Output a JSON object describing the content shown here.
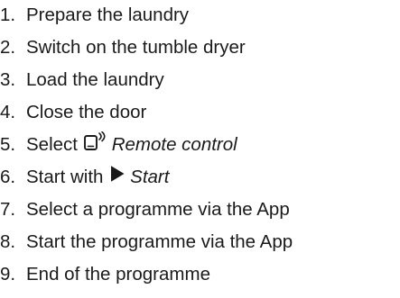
{
  "steps": [
    {
      "number": "1.",
      "text": "Prepare the laundry"
    },
    {
      "number": "2.",
      "text": "Switch on the tumble dryer"
    },
    {
      "number": "3.",
      "text": "Load the laundry"
    },
    {
      "number": "4.",
      "text": "Close the door"
    },
    {
      "number": "5.",
      "prefix": "Select",
      "icon": "remote-control-icon",
      "emphasis": "Remote control"
    },
    {
      "number": "6.",
      "prefix": "Start with",
      "icon": "play-icon",
      "emphasis": "Start"
    },
    {
      "number": "7.",
      "text": "Select a programme via the App"
    },
    {
      "number": "8.",
      "text": "Start the programme via the App"
    },
    {
      "number": "9.",
      "text": "End of the programme"
    }
  ]
}
